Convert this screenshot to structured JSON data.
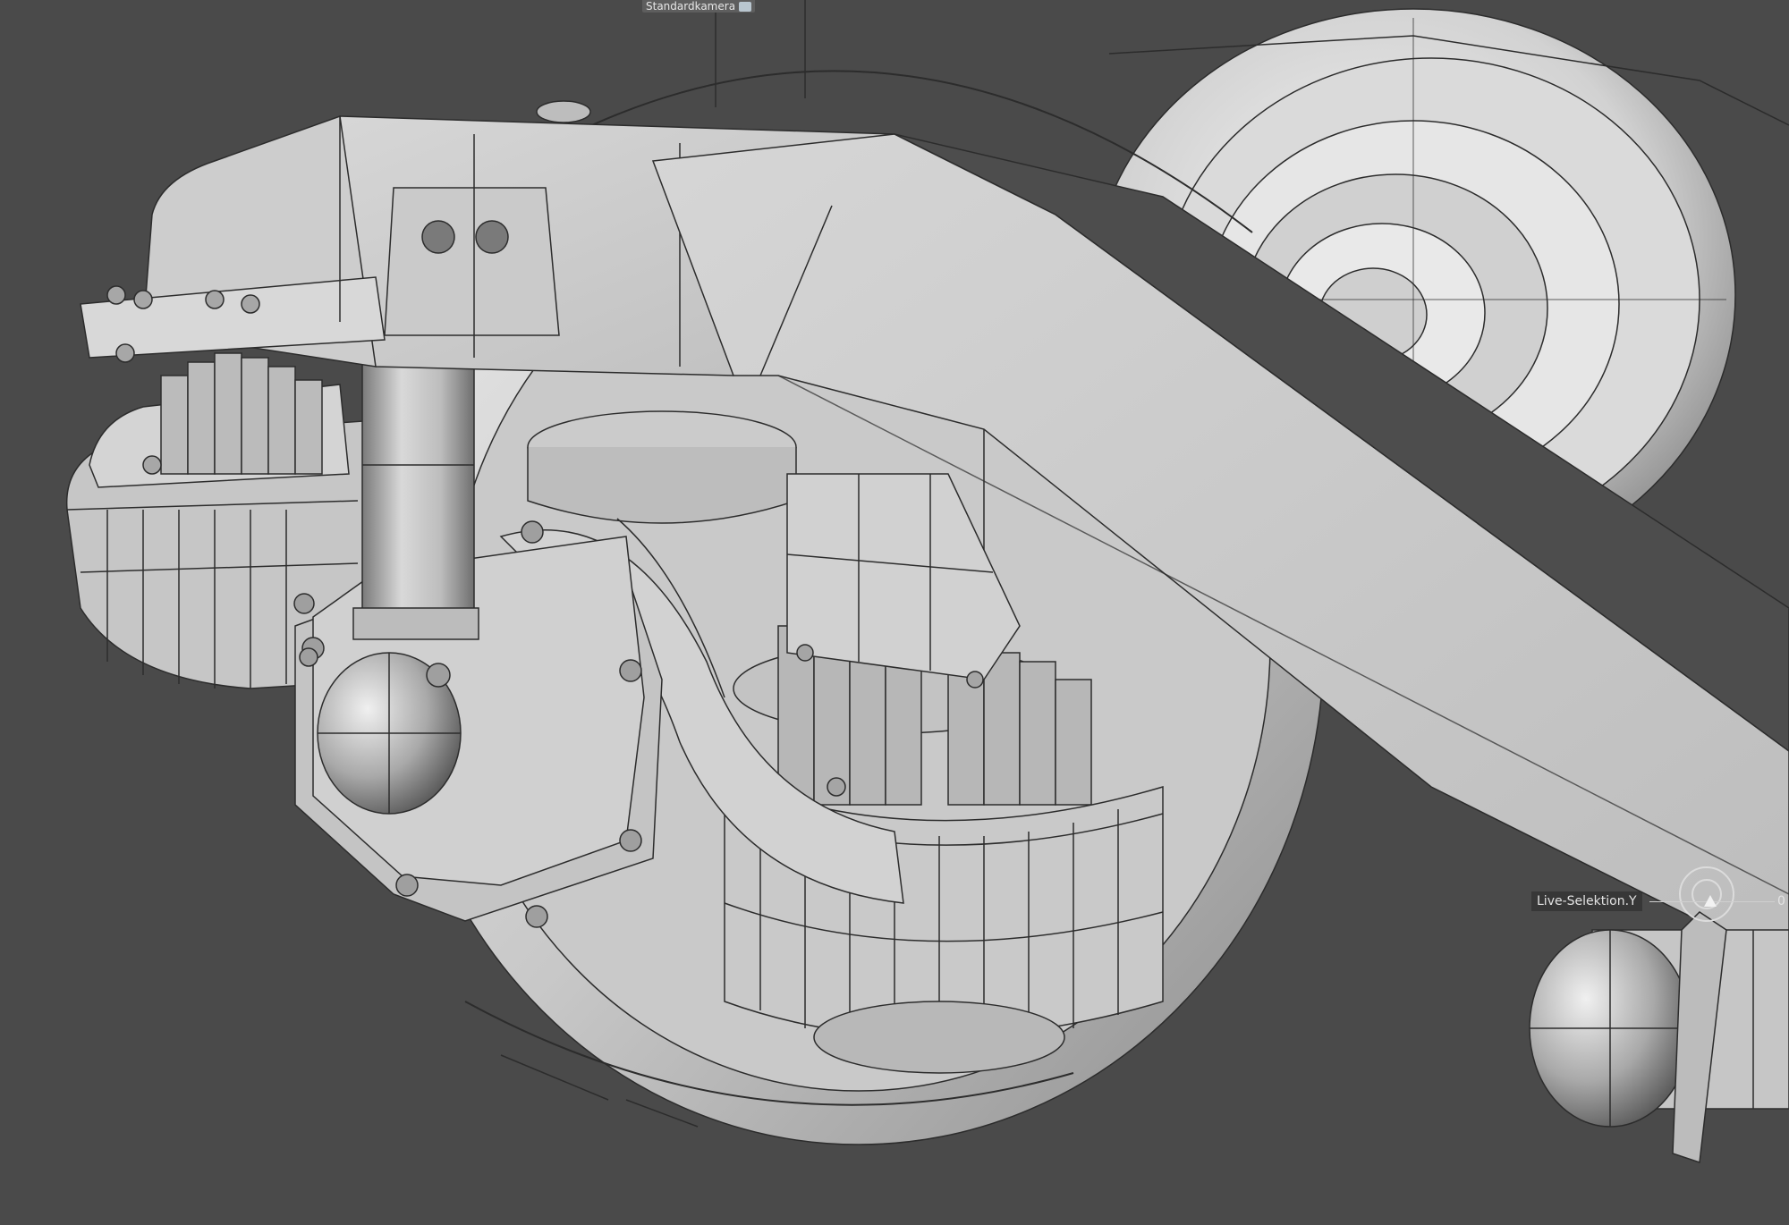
{
  "viewport": {
    "camera_label": "Standardkamera",
    "camera_icon": "camera-icon",
    "background_color": "#4a4a4a"
  },
  "hud": {
    "label": "Live-Selektion.Y",
    "value": "0",
    "icon": "rotate-gizmo-icon"
  },
  "scene": {
    "subject": "bogie-wheel-suspension-wireframe-model",
    "mesh_color": "#c7c7c7",
    "wire_color": "#2c2c2c"
  }
}
